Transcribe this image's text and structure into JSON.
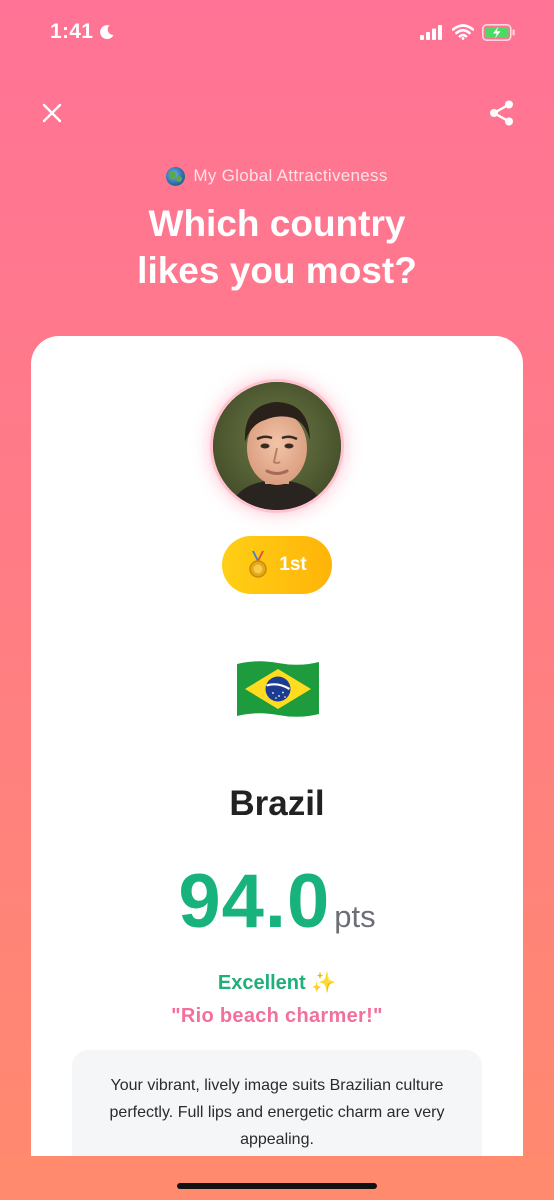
{
  "status_bar": {
    "time": "1:41",
    "icons": [
      "moon-icon",
      "cellular-signal-icon",
      "wifi-icon",
      "battery-charging-icon"
    ]
  },
  "top_bar": {
    "close_icon": "close-icon",
    "share_icon": "share-icon"
  },
  "header": {
    "subtitle": "My Global Attractiveness",
    "subtitle_icon": "globe-icon",
    "headline_line1": "Which country",
    "headline_line2": "likes you most?"
  },
  "result": {
    "rank_label": "1st",
    "rank_icon": "medal-icon",
    "flag_icon": "brazil-flag-icon",
    "country": "Brazil",
    "score": "94.0",
    "score_unit": "pts",
    "rating": "Excellent ✨",
    "quote": "\"Rio beach charmer!\"",
    "description": "Your vibrant, lively image suits Brazilian culture perfectly. Full lips and energetic charm are very appealing."
  },
  "colors": {
    "background_top": "#ff7396",
    "background_bottom": "#ff8a6e",
    "score_green": "#18b27c",
    "quote_pink": "#f3709a",
    "badge_gold": "#ffc20e"
  }
}
